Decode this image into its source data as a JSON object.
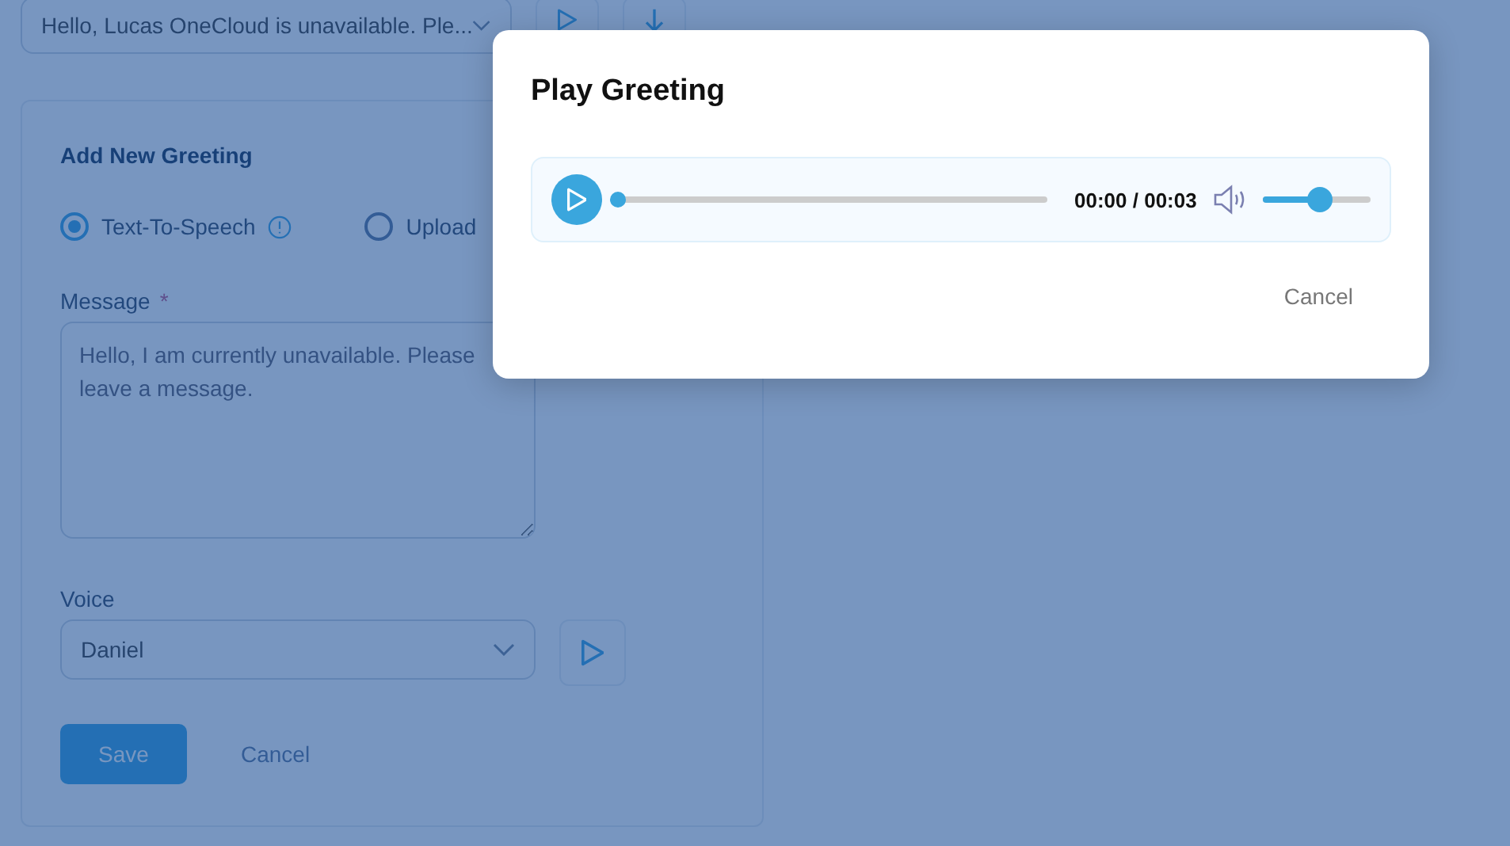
{
  "greeting_select": {
    "value": "Hello, Lucas OneCloud is unavailable. Ple..."
  },
  "add_greeting": {
    "title": "Add New Greeting",
    "sources": [
      {
        "label": "Text-To-Speech",
        "selected": true,
        "info": true
      },
      {
        "label": "Upload",
        "selected": false,
        "info": false
      }
    ],
    "message": {
      "label": "Message",
      "required": "*",
      "value": "Hello, I am currently unavailable. Please leave a message."
    },
    "voice": {
      "label": "Voice",
      "value": "Daniel"
    },
    "buttons": {
      "save": "Save",
      "cancel": "Cancel"
    }
  },
  "dialog": {
    "title": "Play Greeting",
    "player": {
      "progress": {
        "level": 0
      },
      "time": "00:00 / 00:03",
      "volume": {
        "level": 0.52
      }
    },
    "cancel": "Cancel"
  }
}
